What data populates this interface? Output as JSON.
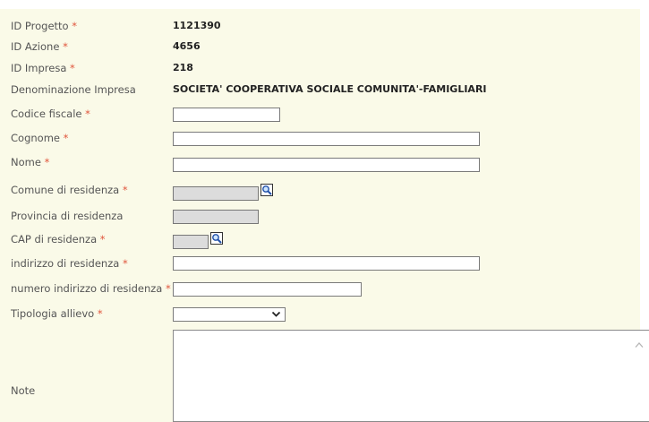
{
  "required_mark": "*",
  "fields": {
    "id_progetto": {
      "label": "ID Progetto",
      "value": "1121390"
    },
    "id_azione": {
      "label": "ID Azione",
      "value": "4656"
    },
    "id_impresa": {
      "label": "ID Impresa",
      "value": "218"
    },
    "denominazione": {
      "label": "Denominazione Impresa",
      "value": "SOCIETA' COOPERATIVA SOCIALE COMUNITA'-FAMIGLIARI"
    },
    "codice_fiscale": {
      "label": "Codice fiscale",
      "value": ""
    },
    "cognome": {
      "label": "Cognome",
      "value": ""
    },
    "nome": {
      "label": "Nome",
      "value": ""
    },
    "comune": {
      "label": "Comune di residenza",
      "value": ""
    },
    "provincia": {
      "label": "Provincia di residenza",
      "value": ""
    },
    "cap": {
      "label": "CAP di residenza",
      "value": ""
    },
    "indirizzo": {
      "label": "indirizzo di residenza",
      "value": ""
    },
    "numero_indirizzo": {
      "label": "numero indirizzo di residenza",
      "value": ""
    },
    "tipologia": {
      "label": "Tipologia allievo",
      "selected": ""
    },
    "note": {
      "label": "Note",
      "value": ""
    }
  },
  "colors": {
    "form_background": "#fafae8",
    "required": "#e0553c",
    "label": "#555555",
    "disabled_input": "#dcdcdc"
  },
  "icons": {
    "lookup": "magnifier-icon",
    "dropdown": "chevron-down-icon",
    "scroll": "scroll-up-arrow-icon"
  }
}
